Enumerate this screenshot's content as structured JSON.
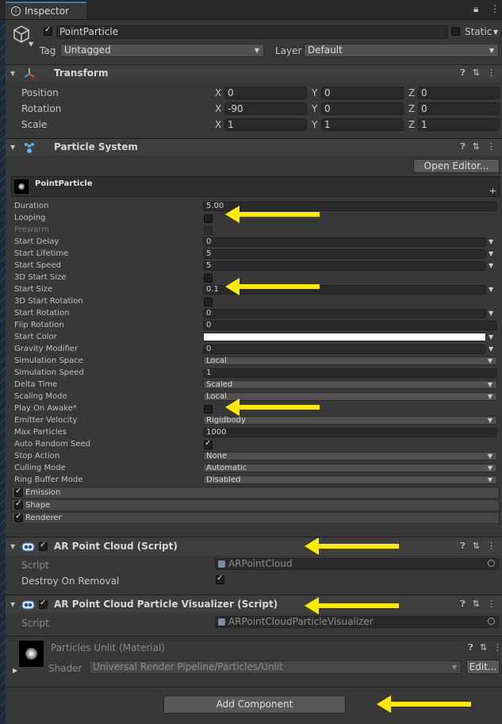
{
  "tab": {
    "title": "Inspector"
  },
  "object": {
    "name": "PointParticle",
    "static_label": "Static",
    "tag_label": "Tag",
    "tag_value": "Untagged",
    "layer_label": "Layer",
    "layer_value": "Default"
  },
  "transform": {
    "title": "Transform",
    "rows": [
      {
        "label": "Position",
        "x": "0",
        "y": "0",
        "z": "0"
      },
      {
        "label": "Rotation",
        "x": "-90",
        "y": "0",
        "z": "0"
      },
      {
        "label": "Scale",
        "x": "1",
        "y": "1",
        "z": "1"
      }
    ],
    "axis": {
      "x": "X",
      "y": "Y",
      "z": "Z"
    }
  },
  "particle_system": {
    "title": "Particle System",
    "open_editor": "Open Editor...",
    "module_name": "PointParticle",
    "plus": "+",
    "properties": [
      {
        "label": "Duration",
        "kind": "field",
        "value": "5.00"
      },
      {
        "label": "Looping",
        "kind": "check",
        "checked": false
      },
      {
        "label": "Prewarm",
        "kind": "check",
        "checked": false,
        "disabled": true
      },
      {
        "label": "Start Delay",
        "kind": "field_dd",
        "value": "0"
      },
      {
        "label": "Start Lifetime",
        "kind": "field_dd",
        "value": "5"
      },
      {
        "label": "Start Speed",
        "kind": "field_dd",
        "value": "5"
      },
      {
        "label": "3D Start Size",
        "kind": "check",
        "checked": false
      },
      {
        "label": "Start Size",
        "kind": "field_dd",
        "value": "0.1"
      },
      {
        "label": "3D Start Rotation",
        "kind": "check",
        "checked": false
      },
      {
        "label": "Start Rotation",
        "kind": "field_dd",
        "value": "0"
      },
      {
        "label": "Flip Rotation",
        "kind": "field",
        "value": "0"
      },
      {
        "label": "Start Color",
        "kind": "color",
        "value": "#ffffff"
      },
      {
        "label": "Gravity Modifier",
        "kind": "field_dd",
        "value": "0"
      },
      {
        "label": "Simulation Space",
        "kind": "dropdown",
        "value": "Local"
      },
      {
        "label": "Simulation Speed",
        "kind": "field",
        "value": "1"
      },
      {
        "label": "Delta Time",
        "kind": "dropdown",
        "value": "Scaled"
      },
      {
        "label": "Scaling Mode",
        "kind": "dropdown",
        "value": "Local"
      },
      {
        "label": "Play On Awake*",
        "kind": "check",
        "checked": false
      },
      {
        "label": "Emitter Velocity",
        "kind": "dropdown",
        "value": "Rigidbody"
      },
      {
        "label": "Max Particles",
        "kind": "field",
        "value": "1000"
      },
      {
        "label": "Auto Random Seed",
        "kind": "check",
        "checked": true
      },
      {
        "label": "Stop Action",
        "kind": "dropdown",
        "value": "None"
      },
      {
        "label": "Culling Mode",
        "kind": "dropdown",
        "value": "Automatic"
      },
      {
        "label": "Ring Buffer Mode",
        "kind": "dropdown",
        "value": "Disabled"
      }
    ],
    "modules": [
      "Emission",
      "Shape",
      "Renderer"
    ]
  },
  "ar_point_cloud": {
    "title": "AR Point Cloud (Script)",
    "script_label": "Script",
    "script_value": "ARPointCloud",
    "destroy_label": "Destroy On Removal"
  },
  "visualizer": {
    "title": "AR Point Cloud Particle Visualizer (Script)",
    "script_label": "Script",
    "script_value": "ARPointCloudParticleVisualizer"
  },
  "material": {
    "title": "Particles Unlit (Material)",
    "shader_label": "Shader",
    "shader_value": "Universal Render Pipeline/Particles/Unlit",
    "edit_label": "Edit..."
  },
  "add_component": "Add Component",
  "colors": {
    "accent": "#3a79bb",
    "highlight_arrow": "#ffea00"
  },
  "icons": [
    "info-circle-icon",
    "lock-icon",
    "kebab-menu-icon",
    "cube-icon",
    "transform-axes-icon",
    "particle-system-icon",
    "help-icon",
    "presets-icon",
    "script-icon"
  ]
}
